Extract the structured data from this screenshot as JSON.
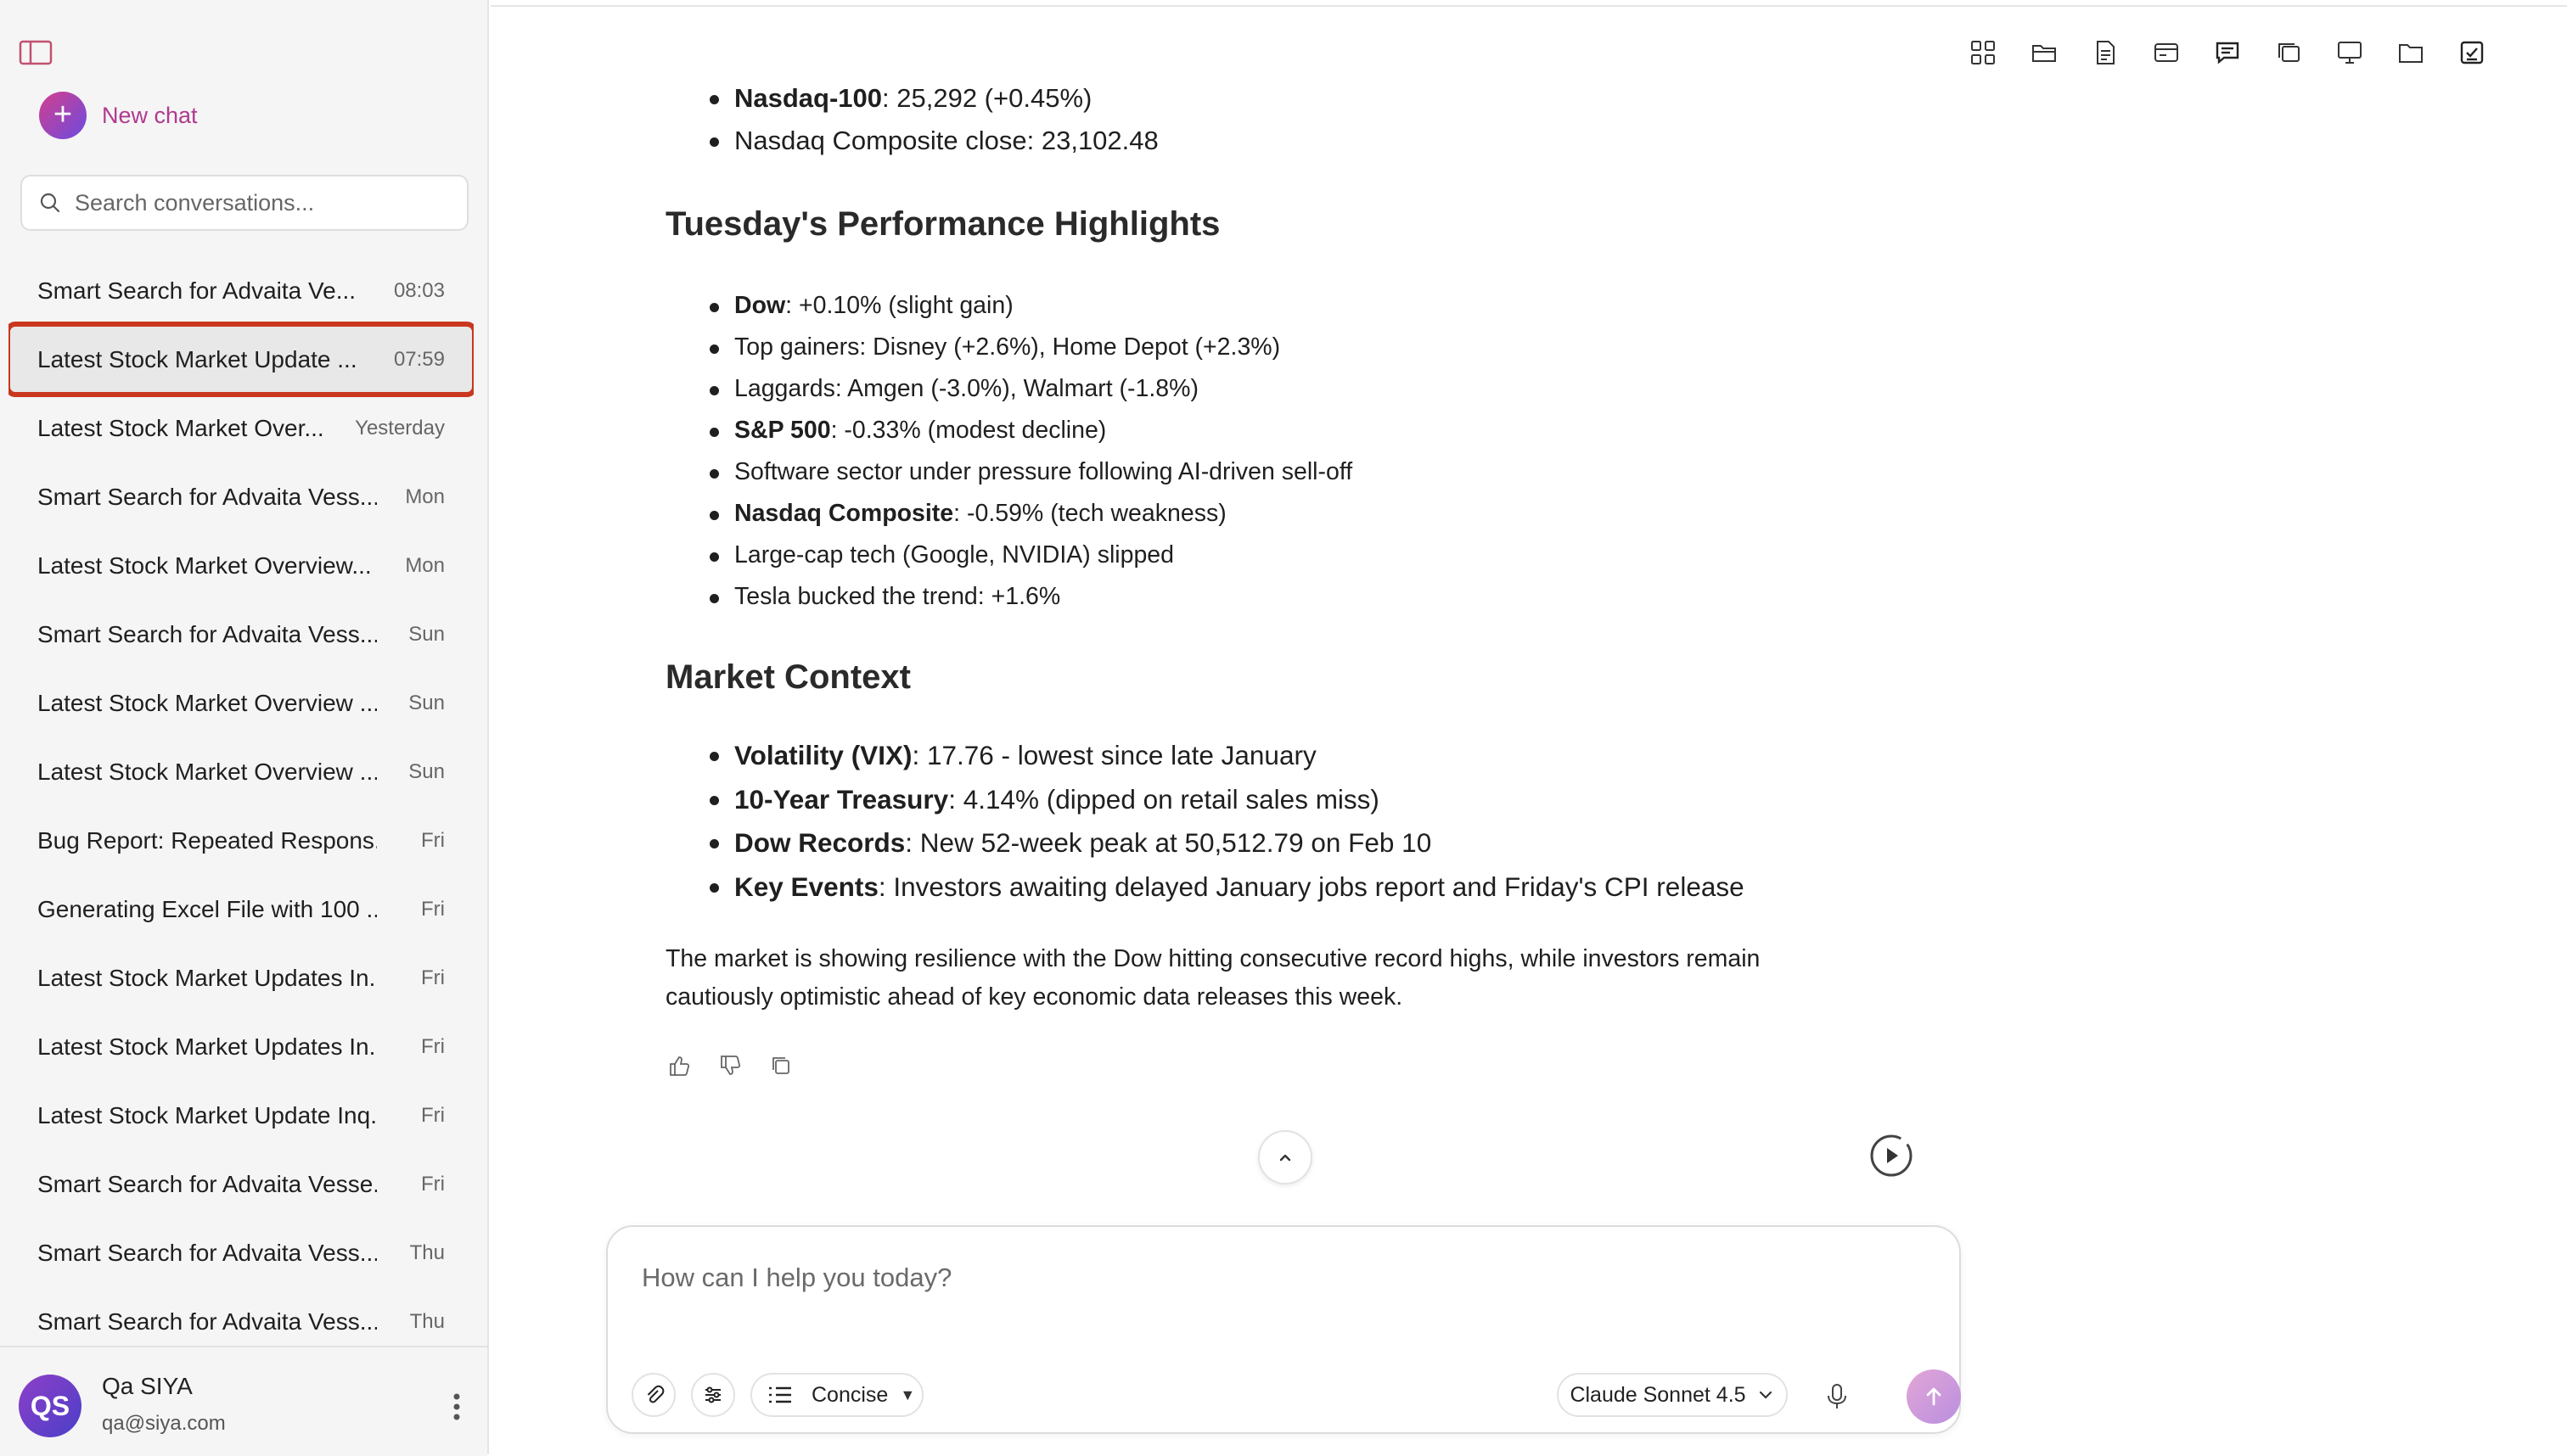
{
  "sidebar": {
    "new_chat_label": "New chat",
    "search_placeholder": "Search conversations...",
    "conversations": [
      {
        "title": "Smart Search for Advaita Ve...",
        "time": "08:03"
      },
      {
        "title": "Latest Stock Market Update ...",
        "time": "07:59"
      },
      {
        "title": "Latest Stock Market Over...",
        "time": "Yesterday"
      },
      {
        "title": "Smart Search for Advaita Vess...",
        "time": "Mon"
      },
      {
        "title": "Latest Stock Market Overview...",
        "time": "Mon"
      },
      {
        "title": "Smart Search for Advaita Vess...",
        "time": "Sun"
      },
      {
        "title": "Latest Stock Market Overview ...",
        "time": "Sun"
      },
      {
        "title": "Latest Stock Market Overview ...",
        "time": "Sun"
      },
      {
        "title": "Bug Report: Repeated Respons...",
        "time": "Fri"
      },
      {
        "title": "Generating Excel File with 100 ...",
        "time": "Fri"
      },
      {
        "title": "Latest Stock Market Updates In...",
        "time": "Fri"
      },
      {
        "title": "Latest Stock Market Updates In...",
        "time": "Fri"
      },
      {
        "title": "Latest Stock Market Update Inq...",
        "time": "Fri"
      },
      {
        "title": "Smart Search for Advaita Vesse...",
        "time": "Fri"
      },
      {
        "title": "Smart Search for Advaita Vess...",
        "time": "Thu"
      },
      {
        "title": "Smart Search for Advaita Vess...",
        "time": "Thu"
      }
    ],
    "active_index": 1,
    "user": {
      "initials": "QS",
      "name": "Qa SIYA",
      "email": "qa@siya.com"
    }
  },
  "message": {
    "truncated_line": {
      "bold": "Nasdaq-100",
      "text": ": 25,292 (+0.45%)"
    },
    "composite_close": "Nasdaq Composite close: 23,102.48",
    "section1_heading": "Tuesday's Performance Highlights",
    "section1_items": [
      {
        "bold": "Dow",
        "text": ": +0.10% (slight gain)"
      },
      {
        "bold": "",
        "text": "Top gainers: Disney (+2.6%), Home Depot (+2.3%)"
      },
      {
        "bold": "",
        "text": "Laggards: Amgen (-3.0%), Walmart (-1.8%)"
      },
      {
        "bold": "S&P 500",
        "text": ": -0.33% (modest decline)"
      },
      {
        "bold": "",
        "text": "Software sector under pressure following AI-driven sell-off"
      },
      {
        "bold": "Nasdaq Composite",
        "text": ": -0.59% (tech weakness)"
      },
      {
        "bold": "",
        "text": "Large-cap tech (Google, NVIDIA) slipped"
      },
      {
        "bold": "",
        "text": "Tesla bucked the trend: +1.6%"
      }
    ],
    "section2_heading": "Market Context",
    "section2_items": [
      {
        "bold": "Volatility (VIX)",
        "text": ": 17.76 - lowest since late January"
      },
      {
        "bold": "10-Year Treasury",
        "text": ": 4.14% (dipped on retail sales miss)"
      },
      {
        "bold": "Dow Records",
        "text": ": New 52-week peak at 50,512.79 on Feb 10"
      },
      {
        "bold": "Key Events",
        "text": ": Investors awaiting delayed January jobs report and Friday's CPI release"
      }
    ],
    "closing_paragraph": "The market is showing resilience with the Dow hitting consecutive record highs, while investors remain cautiously optimistic ahead of key economic data releases this week."
  },
  "composer": {
    "placeholder": "How can I help you today?",
    "style_label": "Concise",
    "model_label": "Claude Sonnet 4.5"
  },
  "colors": {
    "accent_pink": "#b03a8f",
    "highlight_outline": "#c9371f",
    "avatar": "#6b3fc8"
  }
}
